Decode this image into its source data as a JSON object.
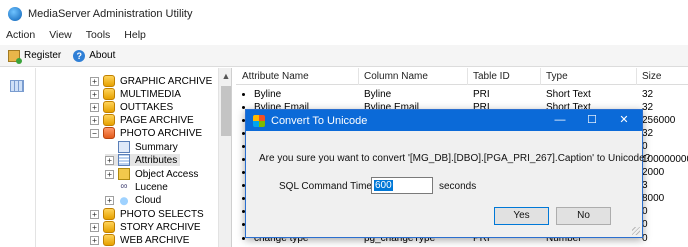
{
  "window": {
    "title": "MediaServer Administration Utility"
  },
  "menu": {
    "items": [
      "Action",
      "View",
      "Tools",
      "Help"
    ]
  },
  "toolbar": {
    "register_label": "Register",
    "about_label": "About"
  },
  "tree": {
    "rows": [
      {
        "label": "GRAPHIC ARCHIVE",
        "expander": "+"
      },
      {
        "label": "MULTIMEDIA",
        "expander": "+"
      },
      {
        "label": "OUTTAKES",
        "expander": "+"
      },
      {
        "label": "PAGE ARCHIVE",
        "expander": "+"
      },
      {
        "label": "PHOTO ARCHIVE",
        "expander": "−"
      },
      {
        "label": "Summary"
      },
      {
        "label": "Attributes",
        "expander": "+"
      },
      {
        "label": "Object Access",
        "expander": "+"
      },
      {
        "label": "Lucene"
      },
      {
        "label": "Cloud",
        "expander": "+"
      },
      {
        "label": "PHOTO SELECTS",
        "expander": "+"
      },
      {
        "label": "STORY ARCHIVE",
        "expander": "+"
      },
      {
        "label": "WEB ARCHIVE",
        "expander": "+"
      }
    ]
  },
  "list": {
    "headers": [
      "Attribute Name",
      "Column Name",
      "Table ID",
      "Type",
      "Size"
    ],
    "rows": [
      [
        "Byline",
        "Byline",
        "PRI",
        "Short Text",
        "32"
      ],
      [
        "Byline Email",
        "Byline Email",
        "PRI",
        "Short Text",
        "32"
      ],
      [
        "",
        "",
        "",
        "",
        "256000"
      ],
      [
        "",
        "",
        "",
        "",
        "32"
      ],
      [
        "",
        "",
        "",
        "",
        "0"
      ],
      [
        "",
        "",
        "",
        "",
        "100000000"
      ],
      [
        "",
        "",
        "",
        "",
        "2000"
      ],
      [
        "",
        "",
        "",
        "",
        "3"
      ],
      [
        "",
        "",
        "",
        "",
        "8000"
      ],
      [
        "",
        "",
        "",
        "",
        "0"
      ],
      [
        "",
        "",
        "",
        "",
        "0"
      ],
      [
        "change type",
        "pg_changeType",
        "PRI",
        "Number",
        "0"
      ]
    ]
  },
  "dialog": {
    "title": "Convert To Unicode",
    "question": "Are you sure you want to convert '[MG_DB].[DBO].[PGA_PRI_267].Caption' to Unicode?",
    "timeout_label": "SQL Command Timeout:",
    "timeout_value": "600",
    "timeout_units": "seconds",
    "yes_label": "Yes",
    "no_label": "No",
    "minimize": "—",
    "maximize": "☐",
    "close": "✕"
  }
}
